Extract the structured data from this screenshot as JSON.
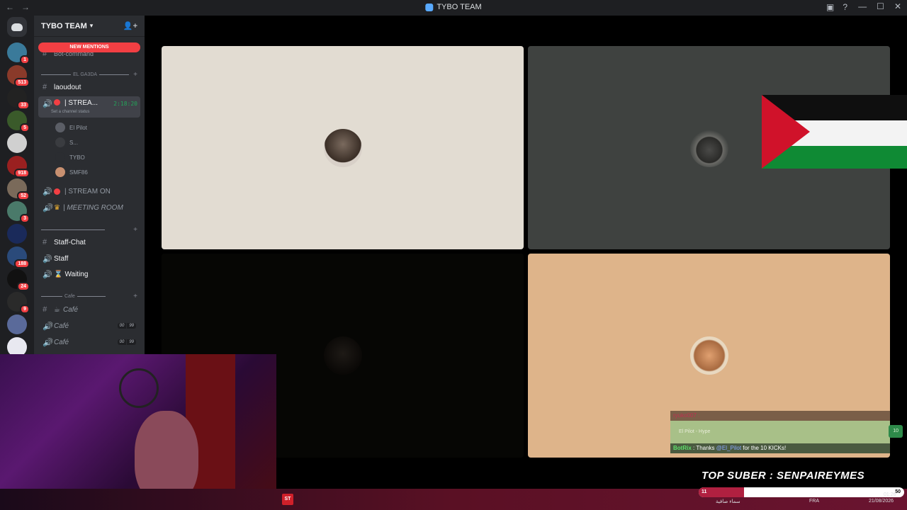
{
  "window": {
    "title": "TYBO TEAM",
    "back_icon": "arrow-left-icon",
    "forward_icon": "arrow-right-icon",
    "minimize_label": "—",
    "maximize_label": "☐",
    "close_label": "✕"
  },
  "rail": {
    "servers": [
      {
        "name": "server-1",
        "badge": "1",
        "color": "#3a7a9a"
      },
      {
        "name": "server-2",
        "badge": "513",
        "color": "#8a3a2a"
      },
      {
        "name": "server-3",
        "badge": "33",
        "color": "#222222"
      },
      {
        "name": "server-4",
        "badge": "5",
        "color": "#3a5a2a"
      },
      {
        "name": "server-5",
        "badge": "",
        "color": "#d0d0d0"
      },
      {
        "name": "server-6",
        "badge": "918",
        "color": "#9a2020"
      },
      {
        "name": "server-7",
        "badge": "52",
        "color": "#7a6a5a"
      },
      {
        "name": "server-8",
        "badge": "3",
        "color": "#4a7a6a"
      },
      {
        "name": "server-9",
        "badge": "",
        "color": "#1a2a5a"
      },
      {
        "name": "server-10",
        "badge": "188",
        "color": "#2a4a7a"
      },
      {
        "name": "server-11",
        "badge": "24",
        "color": "#111111"
      },
      {
        "name": "server-12",
        "badge": "9",
        "color": "#2a2a2a"
      },
      {
        "name": "server-13",
        "badge": "",
        "color": "#5a6a9a"
      },
      {
        "name": "server-14",
        "badge": "",
        "color": "#e8e8f0"
      }
    ]
  },
  "sidebar": {
    "server_name": "TYBO TEAM",
    "new_mentions": "NEW MENTIONS",
    "hidden_channel": "Bot-command",
    "category_1": "EL GA3DA",
    "channels": {
      "laoudout": "laoudout",
      "stream_active": "| STREA...",
      "stream_timer": "2:18:20",
      "stream_status": "Set a channel status",
      "stream_on": "| STREAM ON",
      "meeting": "| MEETING ROOM"
    },
    "voice_users": [
      {
        "name": "El Pilot"
      },
      {
        "name": "S..."
      },
      {
        "name": "TYBO"
      },
      {
        "name": "SMF86"
      }
    ],
    "staff_chat": "Staff-Chat",
    "staff": "Staff",
    "waiting": "Waiting",
    "category_cafe": "Cafe",
    "cafe_text": "Café",
    "cafe_voice_1": "Café",
    "cafe_voice_2": "Café",
    "cafe_users_1": "00",
    "cafe_limit_1": "99",
    "cafe_users_2": "00",
    "cafe_limit_2": "99"
  },
  "chat_overlay": {
    "row1_user": "ryuko007",
    "row2_user": "El Pilot",
    "row2_text": "Hype",
    "row2_count": "10",
    "row3_user": "BotRix",
    "row3_text_a": ": Thanks",
    "row3_mention": "@El_Pilot",
    "row3_text_b": "for the 10 KICKs!"
  },
  "stream_overlay": {
    "top_suber": "TOP SUBER : SENPAIREYMES",
    "subs_label": "THIS MONTH SUBSCRIBERS",
    "subs_current": "11",
    "subs_goal": "50",
    "subs_progress": 0.22
  },
  "taskbar": {
    "weather_text": "سماء صافية",
    "language": "FRA",
    "time": "01:26",
    "date": "21/08/2026"
  }
}
